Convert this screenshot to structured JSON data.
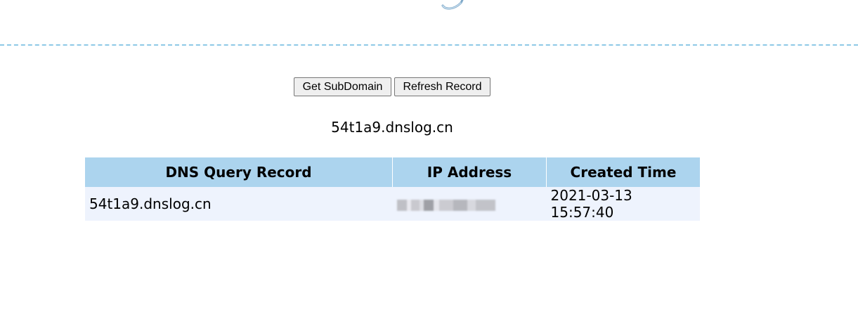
{
  "header": {
    "logo_icon": "dns-logo-icon",
    "divider_color": "#8ec9e6"
  },
  "controls": {
    "get_subdomain_label": "Get SubDomain",
    "refresh_record_label": "Refresh Record"
  },
  "subdomain": {
    "value": "54t1a9.dnslog.cn"
  },
  "records_table": {
    "columns": [
      "DNS Query Record",
      "IP Address",
      "Created Time"
    ],
    "rows": [
      {
        "dns_query_record": "54t1a9.dnslog.cn",
        "ip_address": "",
        "created_time": "2021-03-13 15:57:40"
      }
    ],
    "header_color": "#acd4ee",
    "row_color": "#eef3fd"
  }
}
